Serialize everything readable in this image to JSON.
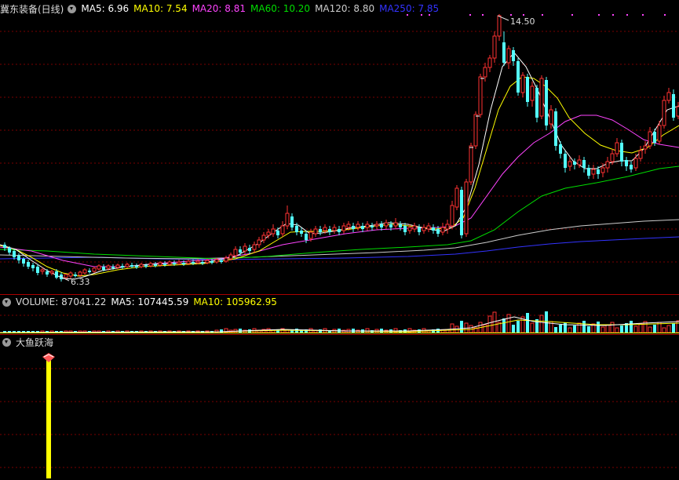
{
  "price_panel": {
    "title": "冀东装备(日线)",
    "ma": [
      {
        "label": "MA5: ",
        "value": "6.96",
        "color": "#ffffff"
      },
      {
        "label": "MA10: ",
        "value": "7.54",
        "color": "#ffff00"
      },
      {
        "label": "MA20: ",
        "value": "8.81",
        "color": "#ff44ff"
      },
      {
        "label": "MA60: ",
        "value": "10.20",
        "color": "#00dd00"
      },
      {
        "label": "MA120: ",
        "value": "8.80",
        "color": "#cccccc"
      },
      {
        "label": "MA250: ",
        "value": "7.85",
        "color": "#3333ff"
      }
    ],
    "high_label": "14.50",
    "low_label": "6.33"
  },
  "volume_panel": {
    "label": "VOLUME: 87041.22",
    "ma5": "MA5: 107445.59",
    "ma10": "MA10: 105962.95"
  },
  "indicator_panel": {
    "title": "大鱼跃海"
  },
  "colors": {
    "up": "#ff3232",
    "down": "#54ffff",
    "grid": "#7a0000",
    "signal_bar": "#ffff00"
  }
}
